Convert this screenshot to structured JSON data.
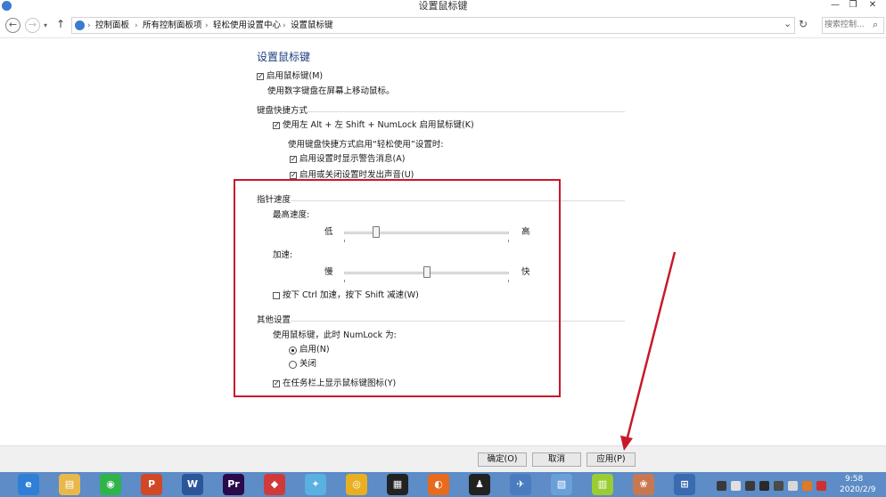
{
  "window": {
    "title": "设置鼠标键",
    "minimize": "—",
    "restore": "❐",
    "close": "✕"
  },
  "address": {
    "back": "←",
    "forward": "→",
    "up": "↑",
    "crumbs": [
      "控制面板",
      "所有控制面板项",
      "轻松使用设置中心",
      "设置鼠标键"
    ],
    "separator": "›",
    "dropdown": "⌄",
    "refresh": "↻",
    "search_placeholder": "搜索控制...",
    "search_icon": "⌕"
  },
  "content": {
    "heading": "设置鼠标键",
    "enable_mouse_keys": {
      "label": "启用鼠标键(M)",
      "checked": true
    },
    "enable_desc": "使用数字键盘在屏幕上移动鼠标。",
    "shortcut_section": "键盘快捷方式",
    "use_shortcut": {
      "label": "使用左 Alt + 左 Shift + NumLock 启用鼠标键(K)",
      "checked": true
    },
    "shortcut_desc": "使用键盘快捷方式启用“轻松使用”设置时:",
    "show_warning": {
      "label": "启用设置时显示警告消息(A)",
      "checked": true
    },
    "play_sound": {
      "label": "启用或关闭设置时发出声音(U)",
      "checked": true
    },
    "pointer_section": "指针速度",
    "top_speed_label": "最高速度:",
    "top_speed_low": "低",
    "top_speed_high": "高",
    "top_speed_value": 0.18,
    "accel_label": "加速:",
    "accel_slow": "慢",
    "accel_fast": "快",
    "accel_value": 0.5,
    "ctrl_shift": {
      "label": "按下 Ctrl 加速，按下 Shift 减速(W)",
      "checked": false
    },
    "other_section": "其他设置",
    "numlock_label": "使用鼠标键，此时 NumLock 为:",
    "radio_on": {
      "label": "启用(N)",
      "selected": true
    },
    "radio_off": {
      "label": "关闭",
      "selected": false
    },
    "show_tray_icon": {
      "label": "在任务栏上显示鼠标键图标(Y)",
      "checked": true
    }
  },
  "buttons": {
    "ok": "确定(O)",
    "cancel": "取消",
    "apply": "应用(P)"
  },
  "taskbar": {
    "icons": [
      {
        "name": "ie-icon",
        "glyph": "e",
        "color": "#2f7fd6"
      },
      {
        "name": "explorer-icon",
        "glyph": "▤",
        "color": "#e9b84a"
      },
      {
        "name": "wechat-icon",
        "glyph": "◉",
        "color": "#2fb34a"
      },
      {
        "name": "powerpoint-icon",
        "glyph": "P",
        "color": "#d24726"
      },
      {
        "name": "word-icon",
        "glyph": "W",
        "color": "#2b579a"
      },
      {
        "name": "premiere-icon",
        "glyph": "Pr",
        "color": "#2a0a4a"
      },
      {
        "name": "app-icon",
        "glyph": "◆",
        "color": "#d03a3a"
      },
      {
        "name": "bird-icon",
        "glyph": "✦",
        "color": "#5ab0e0"
      },
      {
        "name": "chrome-icon",
        "glyph": "◎",
        "color": "#e8b020"
      },
      {
        "name": "media-icon",
        "glyph": "▦",
        "color": "#222222"
      },
      {
        "name": "orange-app-icon",
        "glyph": "◐",
        "color": "#e86a1c"
      },
      {
        "name": "qq-icon",
        "glyph": "♟",
        "color": "#222222"
      },
      {
        "name": "plane-icon",
        "glyph": "✈",
        "color": "#4a7cc0"
      },
      {
        "name": "notes-icon",
        "glyph": "▧",
        "color": "#6aa0d8"
      },
      {
        "name": "calendar-icon",
        "glyph": "▥",
        "color": "#9acd32"
      },
      {
        "name": "photo-icon",
        "glyph": "❀",
        "color": "#c87850"
      },
      {
        "name": "control-icon",
        "glyph": "⊞",
        "color": "#3a6ab0"
      }
    ],
    "clock_time": "9:58",
    "clock_date": "2020/2/9"
  },
  "colors": {
    "highlight": "#c8182a",
    "taskbar": "#5d8cc6"
  }
}
